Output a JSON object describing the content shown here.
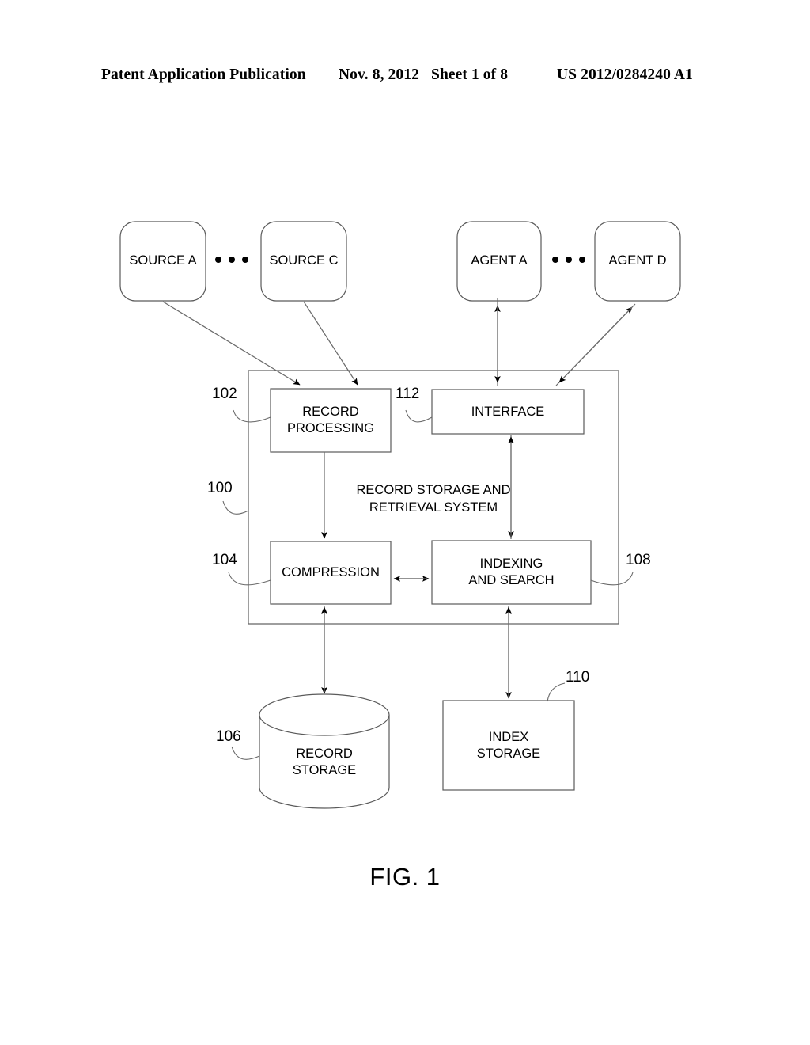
{
  "header": {
    "publication": "Patent Application Publication",
    "date": "Nov. 8, 2012",
    "sheet": "Sheet 1 of 8",
    "patent_number": "US 2012/0284240 A1"
  },
  "figure": {
    "caption": "FIG. 1",
    "system_label": "RECORD STORAGE AND\nRETRIEVAL SYSTEM",
    "system_ref": "100"
  },
  "nodes": {
    "source_a": {
      "label": "SOURCE A"
    },
    "source_c": {
      "label": "SOURCE C"
    },
    "agent_a": {
      "label": "AGENT A"
    },
    "agent_d": {
      "label": "AGENT D"
    },
    "record_processing": {
      "label": "RECORD\nPROCESSING",
      "ref": "102"
    },
    "interface": {
      "label": "INTERFACE",
      "ref": "112"
    },
    "compression": {
      "label": "COMPRESSION",
      "ref": "104"
    },
    "indexing_and_search": {
      "label": "INDEXING\nAND SEARCH",
      "ref": "108"
    },
    "record_storage": {
      "label": "RECORD\nSTORAGE",
      "ref": "106"
    },
    "index_storage": {
      "label": "INDEX\nSTORAGE",
      "ref": "110"
    }
  },
  "colors": {
    "line": "#555555",
    "arrow": "#000000",
    "text": "#000000",
    "background": "#ffffff"
  }
}
